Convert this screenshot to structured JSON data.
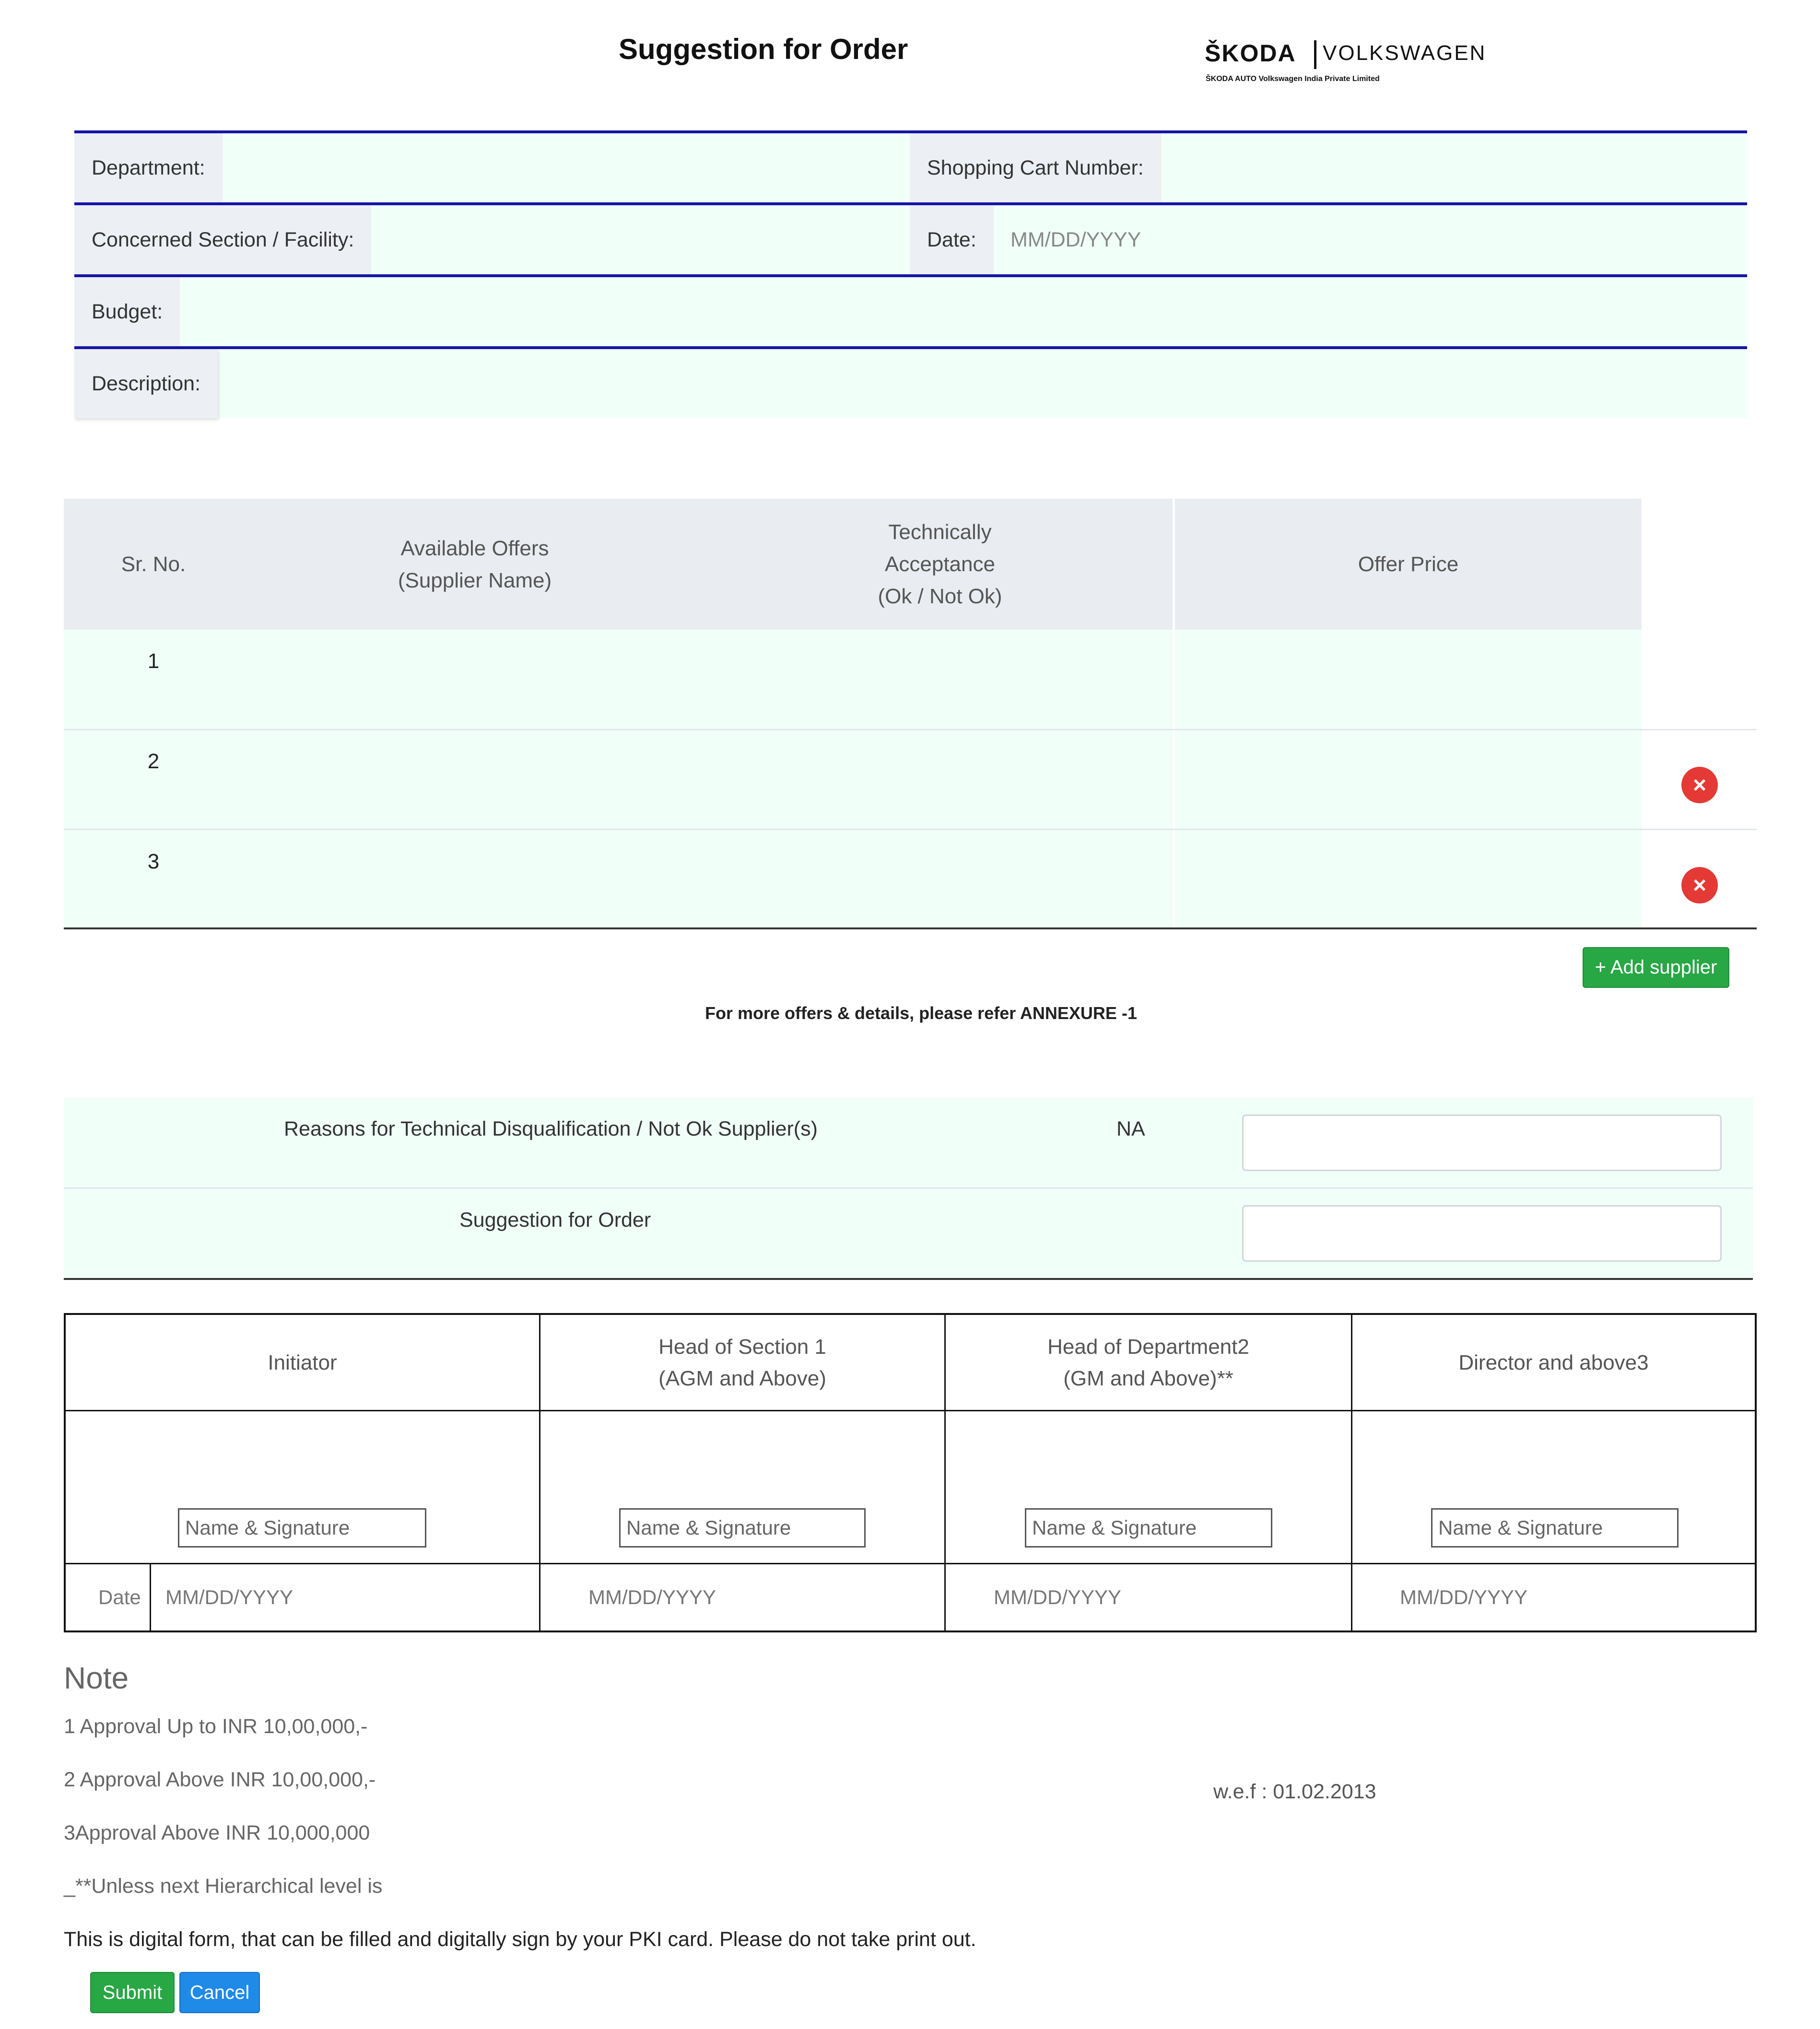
{
  "header": {
    "title": "Suggestion for Order",
    "brand_left": "ŠKODA",
    "brand_right": "VOLKSWAGEN",
    "brand_sub": "ŠKODA AUTO Volkswagen India Private Limited"
  },
  "form": {
    "department_label": "Department:",
    "cart_label": "Shopping Cart Number:",
    "section_label": "Concerned Section / Facility:",
    "date_label": "Date:",
    "date_placeholder": "MM/DD/YYYY",
    "budget_label": "Budget:",
    "description_label": "Description:"
  },
  "offers": {
    "headers": {
      "srno": "Sr. No.",
      "available_1": "Available Offers",
      "available_2": "(Supplier Name)",
      "tech_1": "Technically",
      "tech_2": "Acceptance",
      "tech_3": "(Ok / Not Ok)",
      "price": "Offer Price"
    },
    "rows": [
      "1",
      "2",
      "3"
    ],
    "remove_icon": "×",
    "add_label": "+ Add supplier",
    "annexure_note": "For more offers & details, please refer ANNEXURE -1"
  },
  "reasons": {
    "disq_label": "Reasons for Technical Disqualification / Not Ok Supplier(s)",
    "na": "NA",
    "suggestion_label": "Suggestion for Order"
  },
  "approvals": {
    "initiator": "Initiator",
    "hos_1": "Head of Section 1",
    "hos_2": "(AGM and Above)",
    "hod_1": "Head of Department2",
    "hod_2": "(GM and Above)**",
    "director": "Director and above3",
    "sig_placeholder": "Name & Signature",
    "date_label": "Date",
    "date_placeholder": "MM/DD/YYYY"
  },
  "notes": {
    "heading": "Note",
    "n1": "1 Approval Up to INR 10,00,000,-",
    "n2": "2 Approval Above INR 10,00,000,-",
    "n3": "3Approval Above INR 10,000,000",
    "n4": "_**Unless next Hierarchical level is",
    "wef": "w.e.f : 01.02.2013",
    "digital": "This is digital form, that can be filled and digitally sign by your PKI card. Please do not take print out."
  },
  "actions": {
    "submit": "Submit",
    "cancel": "Cancel"
  }
}
